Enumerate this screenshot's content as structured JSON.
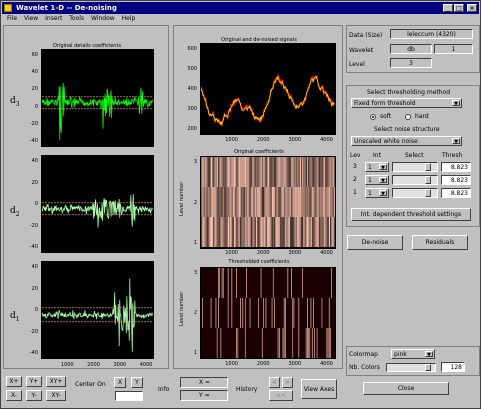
{
  "window": {
    "title": "Wavelet 1-D -- De-noising",
    "controls": [
      "_",
      "□",
      "×"
    ]
  },
  "menu": [
    "File",
    "View",
    "Insert",
    "Tools",
    "Window",
    "Help"
  ],
  "axes": {
    "left_title": "Original details coefficients",
    "signal_title": "Original and de-noised signals",
    "orig_coef_title": "Original coefficients",
    "thr_coef_title": "Thresholded coefficients",
    "level_number_label": "Level number",
    "x_ticks": [
      "1000",
      "2000",
      "3000",
      "4000"
    ],
    "signal_y_ticks": [
      "600",
      "500",
      "400",
      "300",
      "200"
    ],
    "d3_y_ticks": [
      "60",
      "40",
      "20",
      "0",
      "-20",
      "-40"
    ],
    "d2_y_ticks": [
      "40",
      "20",
      "0",
      "-20",
      "-40"
    ],
    "d1_y_ticks": [
      "40",
      "20",
      "0",
      "-20",
      "-40"
    ],
    "level_ticks": [
      "3",
      "2",
      "1"
    ],
    "detail_names": [
      {
        "base": "d",
        "sub": "3"
      },
      {
        "base": "d",
        "sub": "2"
      },
      {
        "base": "d",
        "sub": "1"
      }
    ]
  },
  "info": {
    "data_label": "Data (Size)",
    "data_value": "leleccum (4320)",
    "wavelet_label": "Wavelet",
    "wavelet_family": "db",
    "wavelet_number": "1",
    "level_label": "Level",
    "level_value": "3"
  },
  "threshold": {
    "method_label": "Select thresholding method",
    "method_value": "Fixed form threshold",
    "soft_label": "soft",
    "hard_label": "hard",
    "mode": "soft",
    "noise_label": "Select noise structure",
    "noise_value": "Unscaled white noise",
    "col_lev": "Lev",
    "col_int": "Int",
    "col_select": "Select",
    "col_thresh": "Thresh",
    "rows": [
      {
        "lev": "3",
        "int": "1",
        "thresh": "8.823",
        "fraction": 0.85
      },
      {
        "lev": "2",
        "int": "1",
        "thresh": "8.823",
        "fraction": 0.85
      },
      {
        "lev": "1",
        "int": "1",
        "thresh": "8.823",
        "fraction": 0.85
      }
    ],
    "int_dep_button": "Int. dependent threshold settings"
  },
  "actions": {
    "denoise": "De-noise",
    "residuals": "Residuals",
    "close": "Close"
  },
  "colormap": {
    "label": "Colormap",
    "value": "pink",
    "nb_colors_label": "Nb. Colors",
    "nb_colors_value": "128",
    "slider_fraction": 0.9
  },
  "bottom": {
    "x_plus": "X+",
    "y_plus": "Y+",
    "xy_plus": "XY+",
    "x_minus": "X-",
    "y_minus": "Y-",
    "xy_minus": "XY-",
    "center_on": "Center On",
    "center_x": "X",
    "center_y": "Y",
    "info": "Info",
    "x_eq": "X =",
    "y_eq": "Y =",
    "history": "History",
    "hist_fwd": ">",
    "hist_back": "<",
    "hist_back2": "<<",
    "view_axes": "View Axes"
  },
  "colors": {
    "title_bar": "#000080",
    "window_bg": "#c0c0c0",
    "detail_green": "#00ff00",
    "detail_lightgreen": "#a8ffa8",
    "signal_red": "#ff2000",
    "signal_yellow": "#ffe000",
    "threshold_line": "#ffb060"
  }
}
